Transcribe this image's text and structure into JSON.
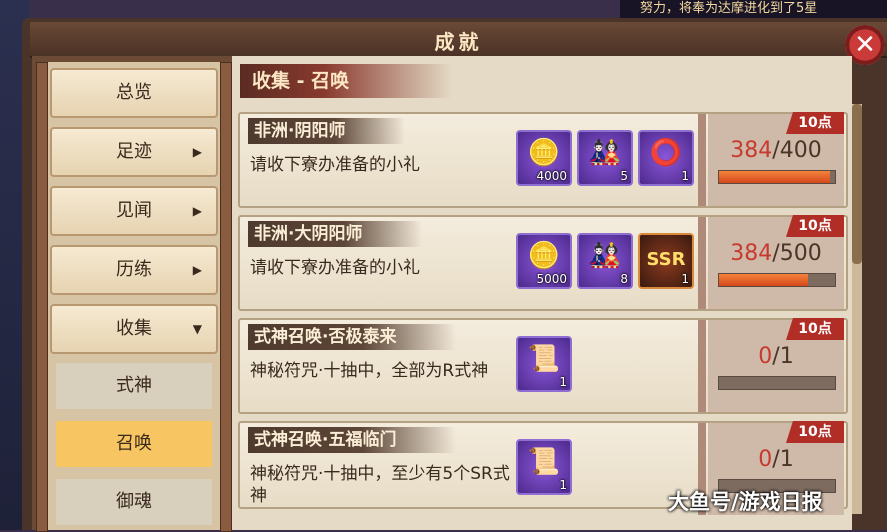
{
  "ticker": "努力，将奉为达摩进化到了5星",
  "window": {
    "title": "成就",
    "close_glyph": "✕"
  },
  "section_title": "收集 - 召唤",
  "sidebar": {
    "items": [
      {
        "label": "总览"
      },
      {
        "label": "足迹",
        "arrow": "▶"
      },
      {
        "label": "见闻",
        "arrow": "▶"
      },
      {
        "label": "历练",
        "arrow": "▶"
      },
      {
        "label": "收集",
        "arrow": "▼"
      }
    ],
    "subitems": [
      {
        "label": "式神"
      },
      {
        "label": "召唤",
        "active": true
      },
      {
        "label": "御魂"
      }
    ]
  },
  "achievements": [
    {
      "title": "非洲·阴阳师",
      "desc": "请收下寮办准备的小礼",
      "rewards": [
        {
          "icon": "coin-bag-icon",
          "glyph": "🪙",
          "qty": "4000"
        },
        {
          "icon": "daruma-icon",
          "glyph": "🎎",
          "qty": "5"
        },
        {
          "icon": "bead-ring-icon",
          "glyph": "⭕",
          "qty": "1"
        }
      ],
      "points": "10点",
      "current": "384",
      "total": "/400",
      "fraction": 0.96
    },
    {
      "title": "非洲·大阴阳师",
      "desc": "请收下寮办准备的小礼",
      "rewards": [
        {
          "icon": "coin-bag-icon",
          "glyph": "🪙",
          "qty": "5000"
        },
        {
          "icon": "daruma-icon",
          "glyph": "🎎",
          "qty": "8"
        },
        {
          "icon": "ssr-icon",
          "glyph": "SSR",
          "qty": "1"
        }
      ],
      "points": "10点",
      "current": "384",
      "total": "/500",
      "fraction": 0.768
    },
    {
      "title": "式神召唤·否极泰来",
      "desc": "神秘符咒·十抽中，全部为R式神",
      "rewards": [
        {
          "icon": "mystery-talisman-icon",
          "glyph": "📜",
          "qty": "1"
        }
      ],
      "points": "10点",
      "current": "0",
      "total": "/1",
      "fraction": 0
    },
    {
      "title": "式神召唤·五福临门",
      "desc": "神秘符咒·十抽中，至少有5个SR式神",
      "rewards": [
        {
          "icon": "mystery-talisman-icon",
          "glyph": "📜",
          "qty": "1"
        }
      ],
      "points": "10点",
      "current": "0",
      "total": "/1",
      "fraction": 0
    }
  ],
  "watermark": "大鱼号/游戏日报"
}
